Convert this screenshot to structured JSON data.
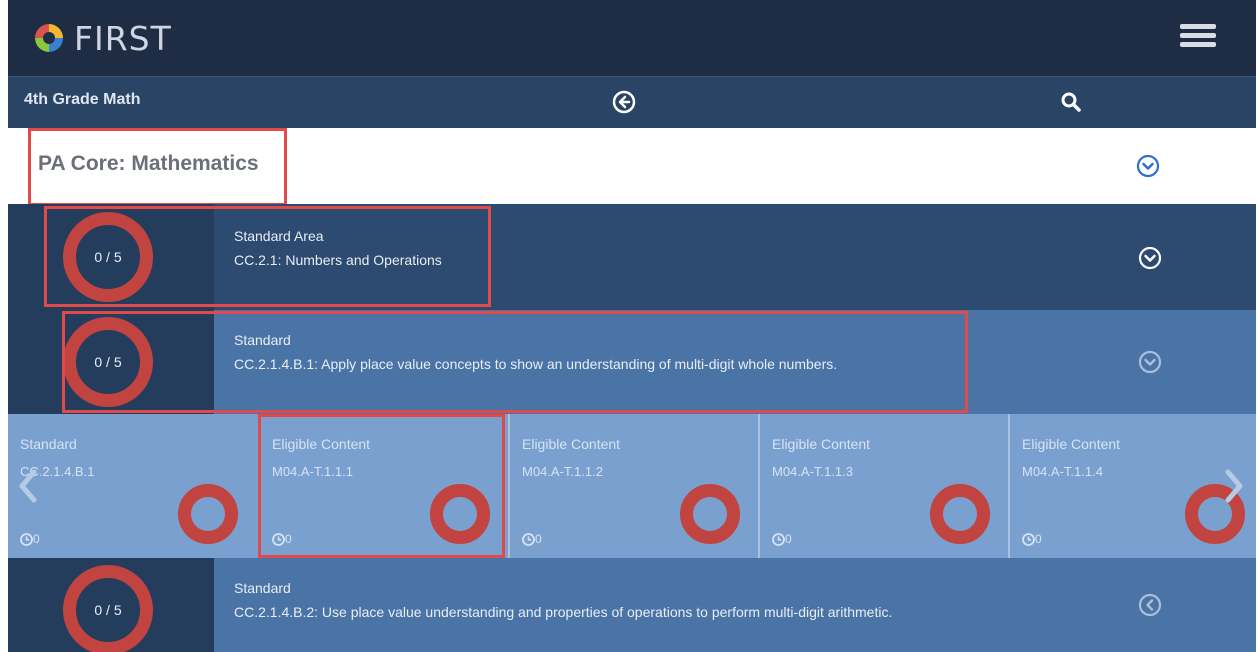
{
  "header": {
    "brand": "FIRST",
    "menu_icon": "hamburger-icon"
  },
  "navbar": {
    "course_title": "4th Grade Math",
    "back_icon": "arrow-left-circle-icon",
    "search_icon": "search-icon"
  },
  "framework": {
    "title": "PA Core: Mathematics"
  },
  "rows": [
    {
      "progress": "0 / 5",
      "type": "Standard Area",
      "text": "CC.2.1: Numbers and Operations"
    },
    {
      "progress": "0 / 5",
      "type": "Standard",
      "text": "CC.2.1.4.B.1: Apply place value concepts to show an understanding of multi-digit whole numbers."
    },
    {
      "progress": "0 / 5",
      "type": "Standard",
      "text": "CC.2.1.4.B.2: Use place value understanding and properties of operations to perform multi-digit arithmetic."
    }
  ],
  "cards": [
    {
      "title": "Standard",
      "code": "CC.2.1.4.B.1",
      "count": "0"
    },
    {
      "title": "Eligible Content",
      "code": "M04.A-T.1.1.1",
      "count": "0"
    },
    {
      "title": "Eligible Content",
      "code": "M04.A-T.1.1.2",
      "count": "0"
    },
    {
      "title": "Eligible Content",
      "code": "M04.A-T.1.1.3",
      "count": "0"
    },
    {
      "title": "Eligible Content",
      "code": "M04.A-T.1.1.4",
      "count": "0"
    }
  ],
  "colors": {
    "header_bg": "#1f2d44",
    "navbar_bg": "#2a4466",
    "accent_red": "#c24440",
    "highlight_box": "#e04a4a",
    "row_blue": "#4a73a6",
    "card_blue": "#7aa0cf"
  }
}
